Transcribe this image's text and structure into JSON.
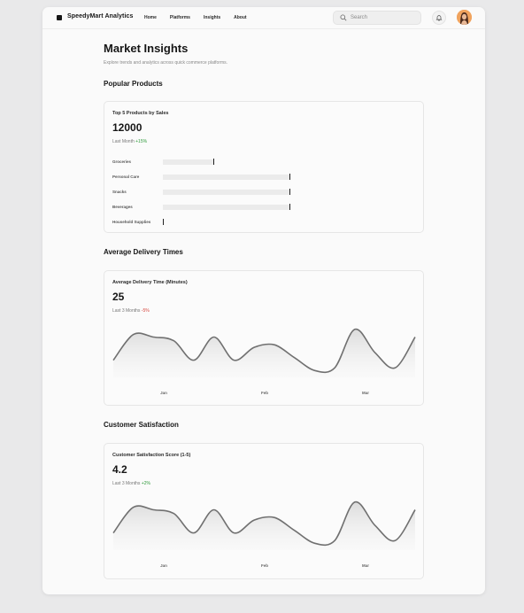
{
  "header": {
    "brand": "SpeedyMart Analytics",
    "nav": [
      "Home",
      "Platforms",
      "Insights",
      "About"
    ],
    "search_placeholder": "Search"
  },
  "page": {
    "title": "Market Insights",
    "subtitle": "Explore trends and analytics across quick commerce platforms."
  },
  "sections": {
    "popular": {
      "title": "Popular Products",
      "card_label": "Top 5 Products by Sales",
      "value": "12000",
      "period": "Last Month",
      "change": "+15%"
    },
    "delivery": {
      "title": "Average Delivery Times",
      "card_label": "Average Delivery Time (Minutes)",
      "value": "25",
      "period": "Last 3 Months",
      "change": "-5%"
    },
    "satisfaction": {
      "title": "Customer Satisfaction",
      "card_label": "Customer Satisfaction Score (1-5)",
      "value": "4.2",
      "period": "Last 3 Months",
      "change": "+2%"
    }
  },
  "colors": {
    "positive": "#2f9a3b",
    "negative": "#d6453d",
    "line": "#707070"
  },
  "chart_data": [
    {
      "type": "bar",
      "orientation": "horizontal",
      "title": "Top 5 Products by Sales",
      "categories": [
        "Groceries",
        "Personal Care",
        "Snacks",
        "Beverages",
        "Household Supplies"
      ],
      "values": [
        40,
        100,
        100,
        100,
        0
      ],
      "xlim": [
        0,
        100
      ]
    },
    {
      "type": "area",
      "title": "Average Delivery Time (Minutes)",
      "categories": [
        "Jan",
        "Feb",
        "Mar"
      ],
      "ylim": [
        0,
        100
      ],
      "series": [
        {
          "values": [
            30,
            80,
            75,
            68,
            30,
            75,
            30,
            55,
            60,
            35,
            10,
            15,
            90,
            45,
            15,
            75
          ]
        }
      ]
    },
    {
      "type": "area",
      "title": "Customer Satisfaction Score (1-5)",
      "categories": [
        "Jan",
        "Feb",
        "Mar"
      ],
      "ylim": [
        0,
        100
      ],
      "series": [
        {
          "values": [
            30,
            80,
            75,
            68,
            30,
            75,
            30,
            55,
            60,
            35,
            10,
            15,
            90,
            45,
            15,
            75
          ]
        }
      ]
    }
  ]
}
